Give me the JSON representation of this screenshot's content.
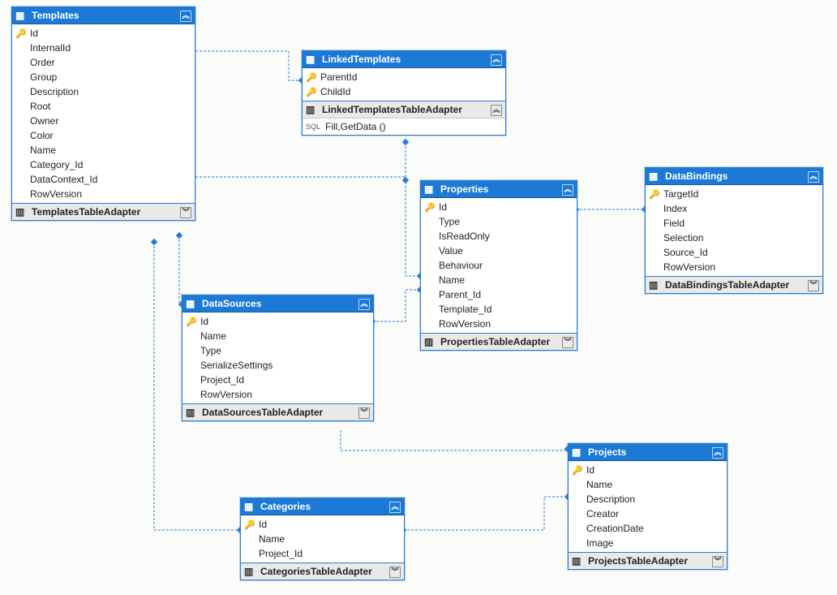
{
  "entities": [
    {
      "title": "Templates",
      "columns": [
        "Id",
        "InternalId",
        "Order",
        "Group",
        "Description",
        "Root",
        "Owner",
        "Color",
        "Name",
        "Category_Id",
        "DataContext_Id",
        "RowVersion"
      ],
      "keys": [
        0
      ],
      "adapter": "TemplatesTableAdapter"
    },
    {
      "title": "LinkedTemplates",
      "columns": [
        "ParentId",
        "ChildId"
      ],
      "keys": [
        0,
        1
      ],
      "adapter": "LinkedTemplatesTableAdapter",
      "methods": [
        "Fill,GetData ()"
      ]
    },
    {
      "title": "Properties",
      "columns": [
        "Id",
        "Type",
        "IsReadOnly",
        "Value",
        "Behaviour",
        "Name",
        "Parent_Id",
        "Template_Id",
        "RowVersion"
      ],
      "keys": [
        0
      ],
      "adapter": "PropertiesTableAdapter"
    },
    {
      "title": "DataBindings",
      "columns": [
        "TargetId",
        "Index",
        "Field",
        "Selection",
        "Source_Id",
        "RowVersion"
      ],
      "keys": [
        0
      ],
      "adapter": "DataBindingsTableAdapter"
    },
    {
      "title": "DataSources",
      "columns": [
        "Id",
        "Name",
        "Type",
        "SerializeSettings",
        "Project_Id",
        "RowVersion"
      ],
      "keys": [
        0
      ],
      "adapter": "DataSourcesTableAdapter"
    },
    {
      "title": "Projects",
      "columns": [
        "Id",
        "Name",
        "Description",
        "Creator",
        "CreationDate",
        "Image"
      ],
      "keys": [
        0
      ],
      "adapter": "ProjectsTableAdapter"
    },
    {
      "title": "Categories",
      "columns": [
        "Id",
        "Name",
        "Project_Id"
      ],
      "keys": [
        0
      ],
      "adapter": "CategoriesTableAdapter"
    }
  ],
  "relationships": [
    {
      "from": "Templates",
      "to": "LinkedTemplates"
    },
    {
      "from": "Templates",
      "to": "Properties"
    },
    {
      "from": "Templates",
      "to": "DataSources"
    },
    {
      "from": "Templates",
      "to": "Categories"
    },
    {
      "from": "LinkedTemplates",
      "to": "Properties"
    },
    {
      "from": "Properties",
      "to": "DataBindings"
    },
    {
      "from": "DataSources",
      "to": "Properties"
    },
    {
      "from": "DataSources",
      "to": "Projects"
    },
    {
      "from": "Categories",
      "to": "Projects"
    }
  ],
  "colors": {
    "header": "#1c7ad6",
    "border": "#2a7bd0",
    "adapterBg": "#e9e9e8"
  }
}
